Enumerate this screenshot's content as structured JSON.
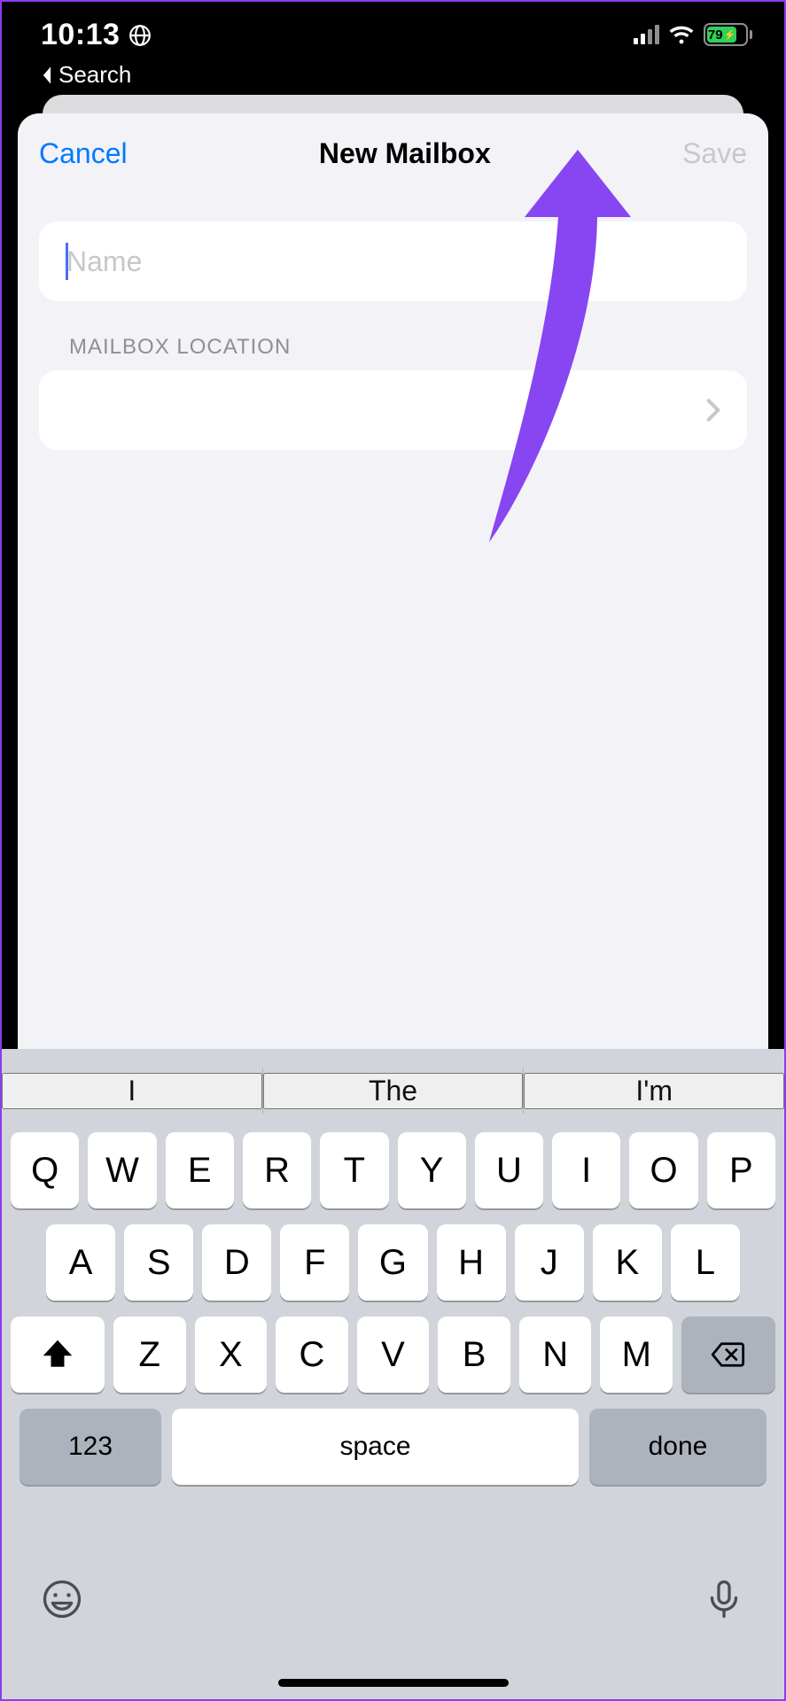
{
  "status_bar": {
    "time": "10:13",
    "back_label": "Search",
    "battery_pct": "79"
  },
  "sheet": {
    "nav": {
      "cancel": "Cancel",
      "title": "New Mailbox",
      "save": "Save"
    },
    "name_placeholder": "Name",
    "location_header": "MAILBOX LOCATION"
  },
  "keyboard": {
    "predictive": [
      "I",
      "The",
      "I'm"
    ],
    "row1": [
      "Q",
      "W",
      "E",
      "R",
      "T",
      "Y",
      "U",
      "I",
      "O",
      "P"
    ],
    "row2": [
      "A",
      "S",
      "D",
      "F",
      "G",
      "H",
      "J",
      "K",
      "L"
    ],
    "row3": [
      "Z",
      "X",
      "C",
      "V",
      "B",
      "N",
      "M"
    ],
    "numbers_label": "123",
    "space_label": "space",
    "done_label": "done"
  }
}
